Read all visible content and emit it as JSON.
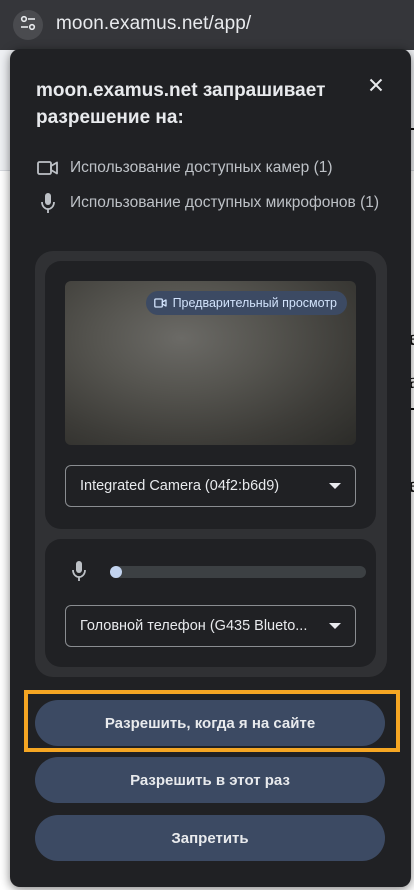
{
  "browser": {
    "url": "moon.examus.net/app/",
    "site_info_icon": "tune-icon"
  },
  "popup": {
    "title_site": "moon.examus.net",
    "title_rest": " запрашивает разрешение на:",
    "close_icon": "close-icon",
    "permissions": [
      {
        "icon": "camera-icon",
        "text": "Использование доступных камер (1)"
      },
      {
        "icon": "microphone-icon",
        "text": "Использование доступных микрофонов (1)"
      }
    ],
    "camera": {
      "preview_label": "Предварительный просмотр",
      "selected_device": "Integrated Camera (04f2:b6d9)"
    },
    "microphone": {
      "level_fraction": 0.03,
      "selected_device": "Головной телефон (G435 Blueto..."
    },
    "buttons": {
      "allow_while_visiting": "Разрешить, когда я на сайте",
      "allow_this_time": "Разрешить в этот раз",
      "deny": "Запретить"
    }
  },
  "colors": {
    "popup_bg": "#202124",
    "panel_bg": "#303134",
    "button_bg": "#3c4a63",
    "highlight": "#f5a623"
  }
}
